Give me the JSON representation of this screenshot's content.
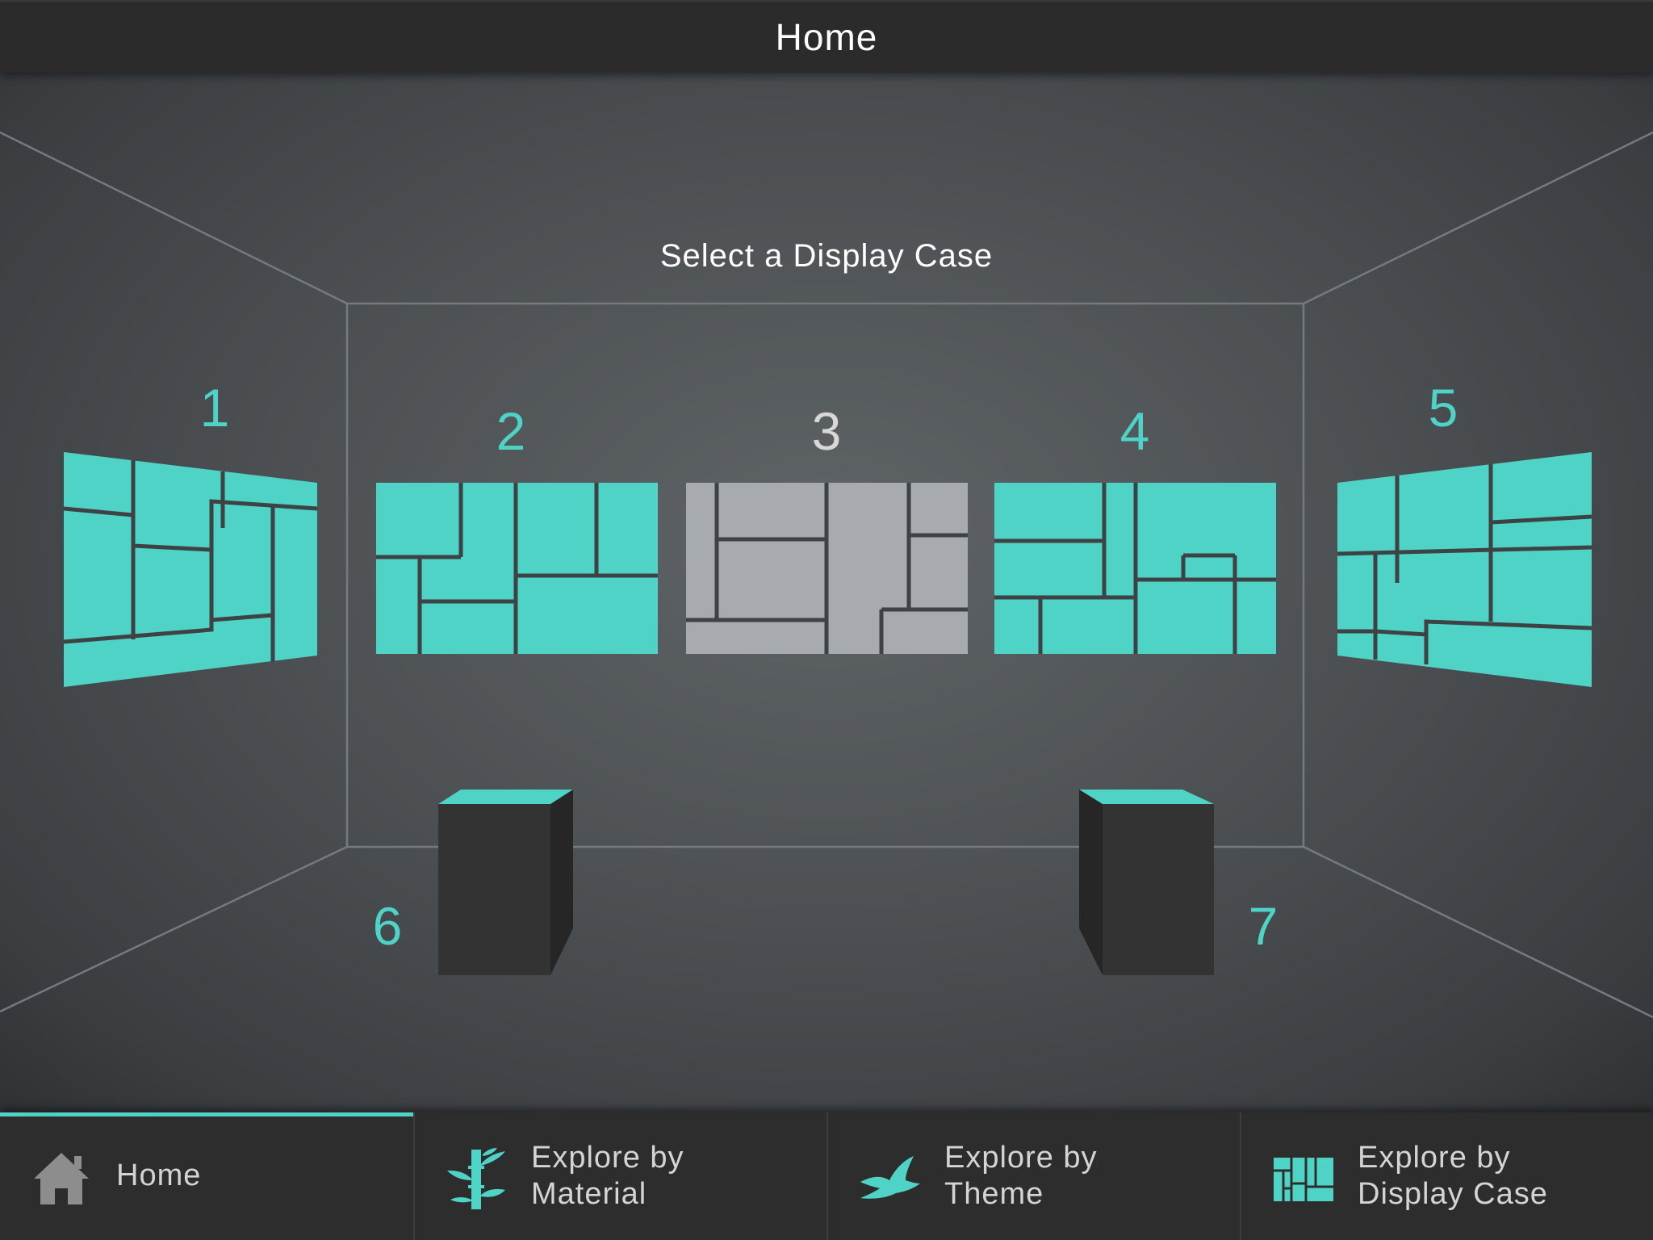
{
  "header": {
    "title": "Home"
  },
  "main": {
    "prompt": "Select a Display Case",
    "cases": [
      {
        "number": "1",
        "selected": false
      },
      {
        "number": "2",
        "selected": false
      },
      {
        "number": "3",
        "selected": true
      },
      {
        "number": "4",
        "selected": false
      },
      {
        "number": "5",
        "selected": false
      },
      {
        "number": "6",
        "selected": false
      },
      {
        "number": "7",
        "selected": false
      }
    ]
  },
  "bottom_nav": {
    "tabs": [
      {
        "label_line1": "Home",
        "label_line2": "",
        "icon": "home-icon",
        "active": true
      },
      {
        "label_line1": "Explore by",
        "label_line2": "Material",
        "icon": "bamboo-icon",
        "active": false
      },
      {
        "label_line1": "Explore by",
        "label_line2": "Theme",
        "icon": "bird-icon",
        "active": false
      },
      {
        "label_line1": "Explore by",
        "label_line2": "Display Case",
        "icon": "display-case-grid-icon",
        "active": false
      }
    ]
  },
  "colors": {
    "accent": "#4fd3c7",
    "selected_case": "#a7aaae",
    "pedestal": "#323232",
    "bar_background": "#2d2d2d"
  }
}
